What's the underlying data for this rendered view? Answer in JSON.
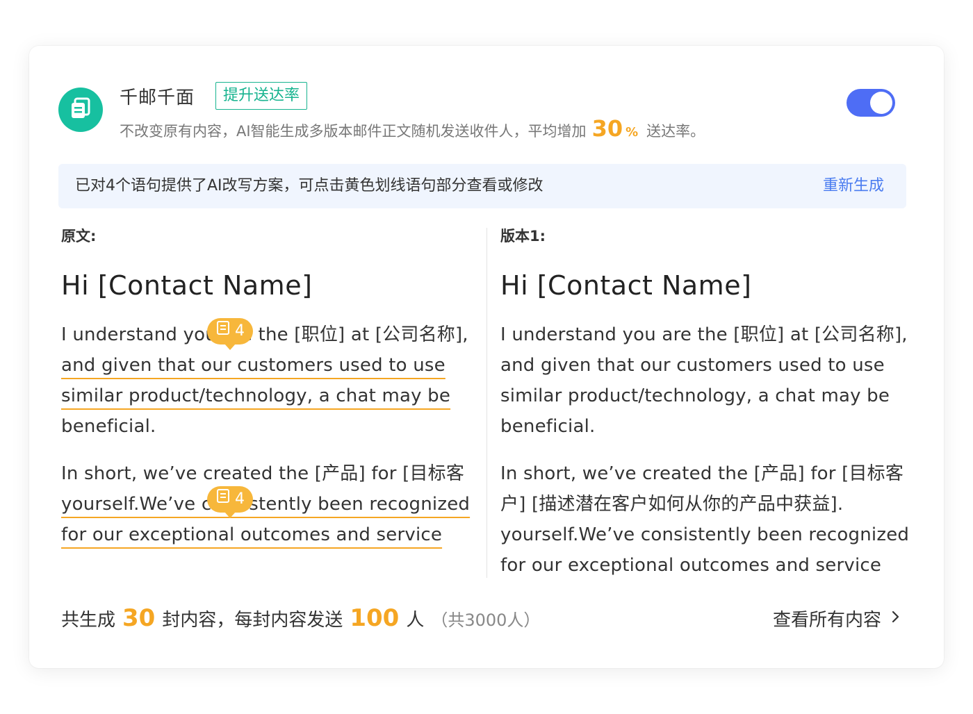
{
  "feature": {
    "title": "千邮千面",
    "tag": "提升送达率",
    "desc_prefix": "不改变原有内容，AI智能生成多版本邮件正文随机发送收件人，平均增加",
    "desc_percent": "30",
    "desc_percent_unit": "%",
    "desc_suffix": "送达率。",
    "enabled": true
  },
  "notice": {
    "text": "已对4个语句提供了AI改写方案，可点击黄色划线语句部分查看或修改",
    "action": "重新生成"
  },
  "original": {
    "label": "原文:",
    "greeting": "Hi [Contact Name]",
    "para1": [
      "I understand you are the [职位] at [公司名称],",
      "and given that our customers used to use",
      "similar product/technology, a chat may be",
      "beneficial."
    ],
    "para2": [
      "In short, we’ve created the [产品] for [目标客",
      "yourself.We’ve consistently been recognized",
      "for our exceptional outcomes and service"
    ],
    "badges": [
      {
        "count": "4"
      },
      {
        "count": "4"
      }
    ]
  },
  "version": {
    "label": "版本1:",
    "greeting": "Hi [Contact Name]",
    "para1": [
      "I understand you are the [职位] at [公司名称],",
      "and given that our customers used to use",
      "similar product/technology, a chat may be",
      "beneficial."
    ],
    "para2": [
      "In short, we’ve created the [产品] for [目标客",
      "户] [描述潜在客户如何从你的产品中获益].",
      "yourself.We’ve consistently been recognized",
      "for our exceptional outcomes and service"
    ]
  },
  "footer": {
    "prefix": "共生成",
    "total_count": "30",
    "mid": "封内容，每封内容发送",
    "per_count": "100",
    "suffix": "人",
    "note": "（共3000人）",
    "view_all": "查看所有内容"
  },
  "colors": {
    "accent_green": "#17c0a0",
    "toggle_blue": "#4e6df5",
    "highlight_orange": "#f5a623",
    "link_blue": "#4a7cf0"
  }
}
